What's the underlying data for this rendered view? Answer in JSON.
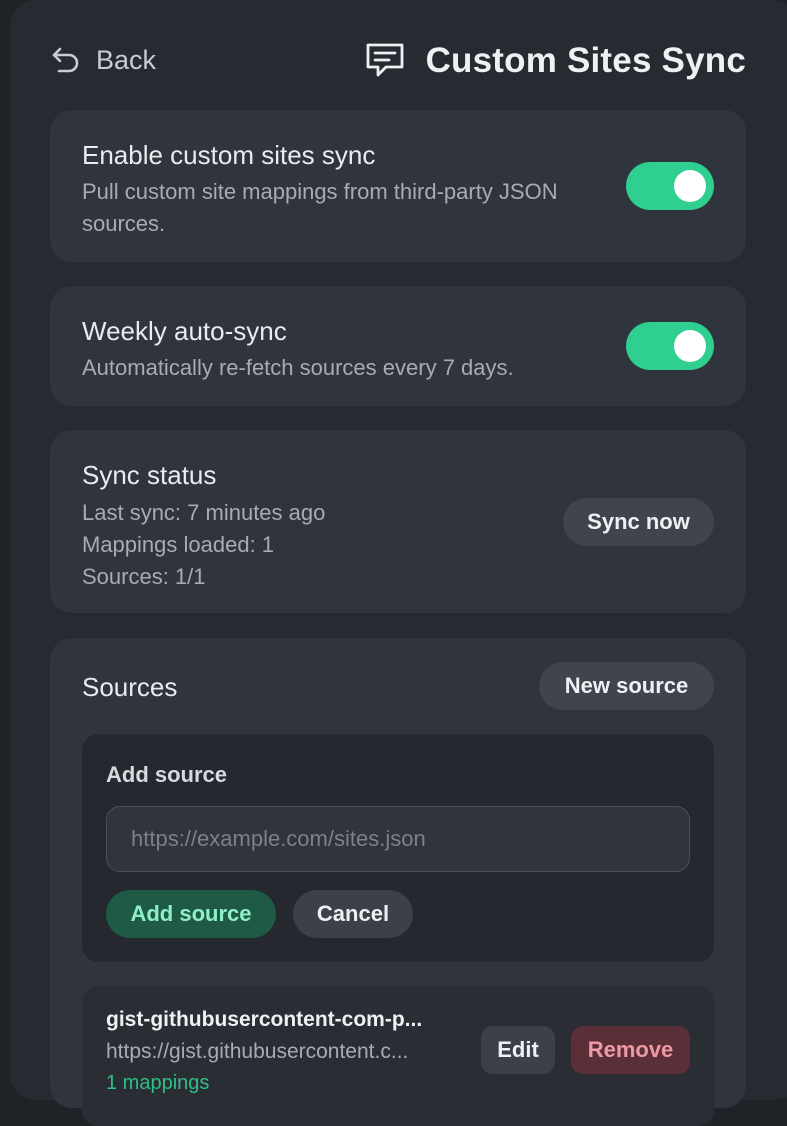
{
  "header": {
    "back_label": "Back",
    "title": "Custom Sites Sync",
    "back_icon": "undo-arrow-icon",
    "title_icon": "chat-bubble-lines-icon"
  },
  "enable_sync": {
    "title": "Enable custom sites sync",
    "description": "Pull custom site mappings from third-party JSON sources.",
    "enabled": true
  },
  "auto_sync": {
    "title": "Weekly auto-sync",
    "description": "Automatically re-fetch sources every 7 days.",
    "enabled": true
  },
  "status": {
    "title": "Sync status",
    "last_sync": "Last sync: 7 minutes ago",
    "mappings_loaded": "Mappings loaded: 1",
    "sources": "Sources: 1/1",
    "sync_now_label": "Sync now"
  },
  "sources": {
    "title": "Sources",
    "new_source_label": "New source",
    "add_form": {
      "label": "Add source",
      "url_value": "",
      "url_placeholder": "https://example.com/sites.json",
      "add_label": "Add source",
      "cancel_label": "Cancel"
    },
    "items": [
      {
        "name": "gist-githubusercontent-com-p...",
        "url": "https://gist.githubusercontent.c...",
        "mappings": "1 mappings",
        "edit_label": "Edit",
        "remove_label": "Remove"
      }
    ]
  },
  "colors": {
    "accent": "#2fcf8f",
    "background": "#262a31",
    "card": "#30343c",
    "danger": "#5a2f37"
  }
}
